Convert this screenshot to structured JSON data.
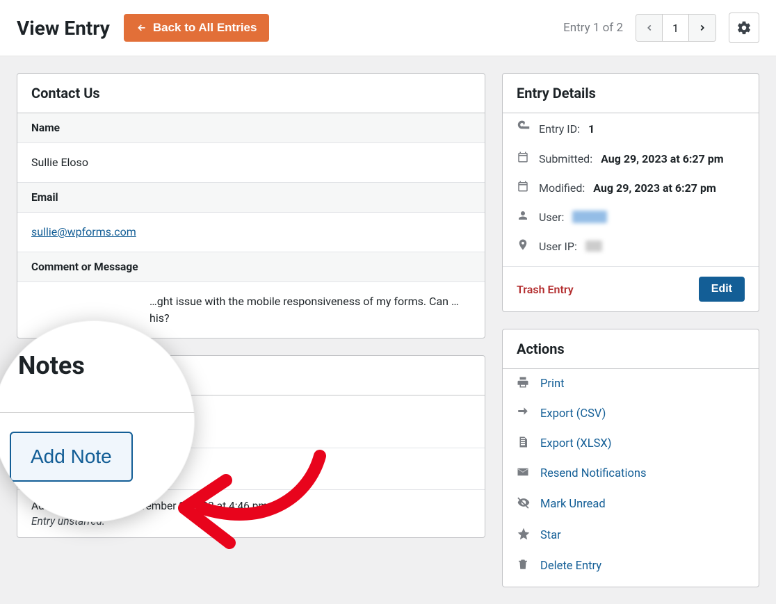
{
  "header": {
    "title": "View Entry",
    "back_label": "Back to All Entries",
    "entry_count_text": "Entry 1 of 2",
    "pager_current": "1"
  },
  "contact_panel": {
    "title": "Contact Us",
    "fields": [
      {
        "label": "Name",
        "value": "Sullie Eloso",
        "is_link": false
      },
      {
        "label": "Email",
        "value": "sullie@wpforms.com",
        "is_link": true
      },
      {
        "label": "Comment or Message",
        "value": "…ght issue with the mobile responsiveness of my forms. Can …his?",
        "is_link": false
      }
    ]
  },
  "notes_panel": {
    "title": "Notes",
    "add_note_label": "Add Note",
    "log": {
      "prefix": "Added by",
      "on_text": "on November 3, 2023 at 4:46 pm",
      "body": "Entry unstarred."
    }
  },
  "details_panel": {
    "title": "Entry Details",
    "entry_id_label": "Entry ID:",
    "entry_id_value": "1",
    "submitted_label": "Submitted:",
    "submitted_value": "Aug 29, 2023 at 6:27 pm",
    "modified_label": "Modified:",
    "modified_value": "Aug 29, 2023 at 6:27 pm",
    "user_label": "User:",
    "userip_label": "User IP:",
    "trash_label": "Trash Entry",
    "edit_label": "Edit"
  },
  "actions_panel": {
    "title": "Actions",
    "items": [
      "Print",
      "Export (CSV)",
      "Export (XLSX)",
      "Resend Notifications",
      "Mark Unread",
      "Star",
      "Delete Entry"
    ]
  },
  "magnifier": {
    "title": "Notes",
    "button": "Add Note"
  }
}
